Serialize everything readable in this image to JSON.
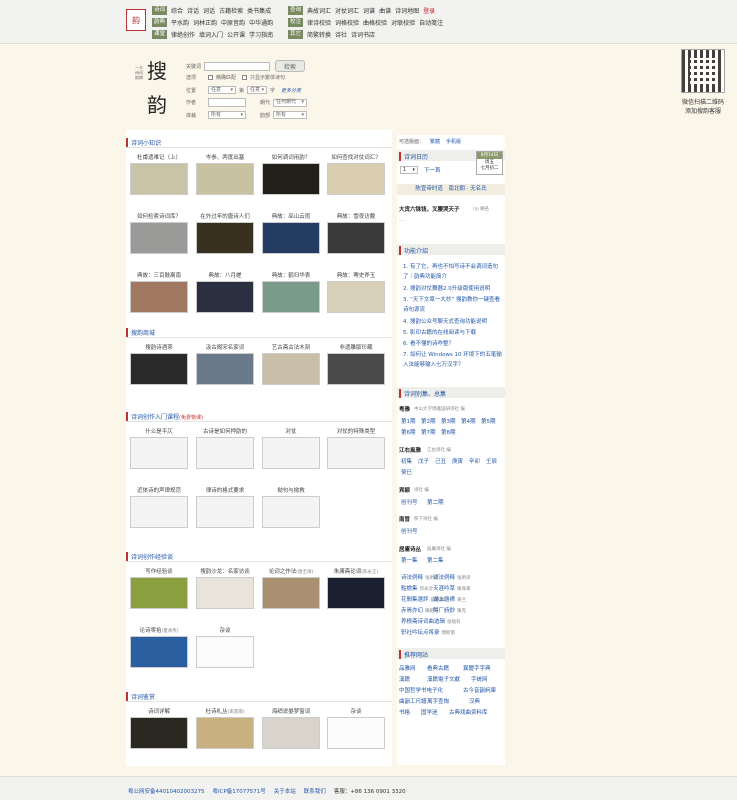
{
  "nav": {
    "logo_char": "韵",
    "row1_tag": "诗词",
    "row1": [
      "综合",
      "诗话",
      "词话",
      "古籍检索",
      "类书集成"
    ],
    "row2_tag": "韵典",
    "row2": [
      "平水韵",
      "词林正韵",
      "中原音韵",
      "中华通韵"
    ],
    "row3_tag": "课堂",
    "row3": [
      "律绝创作",
      "填词入门",
      "公开课",
      "学习指南"
    ],
    "row1b_tag": "查询",
    "row1b": [
      "典故词汇",
      "对仗词汇",
      "词谱",
      "曲谱",
      "诗词地图"
    ],
    "login": "登录",
    "row2b_tag": "校注",
    "row2b": [
      "律诗校验",
      "词格校验",
      "曲格校验",
      "对联校验",
      "自动笺注"
    ],
    "row3b_tag": "其它",
    "row3b": [
      "简繁转换",
      "诗社",
      "诗词书店"
    ]
  },
  "qr": {
    "line1": "微信扫描二维码",
    "line2": "添加搜韵客服"
  },
  "brand": {
    "char1": "搜",
    "char2": "韵",
    "side": "一卡诗词韵典"
  },
  "search": {
    "keyword_label": "关键词",
    "button": "检索",
    "option_label": "选项",
    "opt1": "精确匹配",
    "opt2": "只显示繁体诗句",
    "pos_label": "位置",
    "pos_value": "任意",
    "pos_mid": "第",
    "pos_value2": "任意",
    "pos_unit": "字",
    "more": "更多分类",
    "author_label": "作者",
    "dynasty_label": "朝代",
    "dynasty_value": "任何朝代",
    "genre_label": "体裁",
    "genre_value": "所有",
    "rhyme_label": "韵部",
    "rhyme_value": "所有"
  },
  "sections": {
    "knowledge": "诗词小知识",
    "shop": "搜韵商城",
    "course": "诗词创作入门课程",
    "course_note": "(免费物课)",
    "experience": "诗词创作经验谈",
    "appreciation": "诗词鉴赏"
  },
  "knowledge_items": [
    {
      "t": "杜甫遗难记（上）",
      "c": "#c9c3a8"
    },
    {
      "t": "岑参、两度出塞",
      "c": "#c8c2a0"
    },
    {
      "t": "如何调词用韵？",
      "c": "#222018"
    },
    {
      "t": "如何查找对仗词汇？",
      "c": "#d9cfb0"
    },
    {
      "t": "如何检索诗词库？",
      "c": "#9a9a98"
    },
    {
      "t": "在外过年的唐诗人们",
      "c": "#3a3020"
    },
    {
      "t": "典故：巫山云雨",
      "c": "#243c62"
    },
    {
      "t": "典故：雪夜访戴",
      "c": "#3a3a3a"
    },
    {
      "t": "典故：三百鼓离南",
      "c": "#a07860"
    },
    {
      "t": "典故：八月槎",
      "c": "#2a3040"
    },
    {
      "t": "典故：鹤归华表",
      "c": "#7a9a8a"
    },
    {
      "t": "典故：骞史斧玉",
      "c": "#d8cfb8"
    }
  ],
  "shop_items": [
    {
      "t": "搜韵诗酒茶",
      "c": "#2a2a2a"
    },
    {
      "t": "汲古阁宋名家词",
      "c": "#6a7a8a"
    },
    {
      "t": "艺古斋古法木刻",
      "c": "#c9bea8"
    },
    {
      "t": "非遗雕版珍藏",
      "c": "#4a4a4a"
    }
  ],
  "course_items": [
    {
      "t": "什么是平仄",
      "c": "#f4f4f4"
    },
    {
      "t": "古诗是如何押韵的",
      "c": "#f4f4f4"
    },
    {
      "t": "对仗",
      "c": "#f4f4f4"
    },
    {
      "t": "对仗的特殊类型",
      "c": "#f4f4f4"
    },
    {
      "t": "近体诗的声律规范",
      "c": "#f4f4f4"
    },
    {
      "t": "律诗的格式要求",
      "c": "#f4f4f4"
    },
    {
      "t": "拗句与拗救",
      "c": "#f4f4f4"
    }
  ],
  "exp_items": [
    {
      "t": "写作经验谈",
      "sub": "",
      "c": "#8aa040"
    },
    {
      "t": "搜韵沙龙：名家访谈",
      "sub": "",
      "c": "#e8e4dc"
    },
    {
      "t": "论词之作法",
      "sub": "(唐圭璋)",
      "c": "#a89070"
    },
    {
      "t": "朱庸斋论词",
      "sub": "(陈永正)",
      "c": "#1a2030"
    },
    {
      "t": "论诗零拾",
      "sub": "(夏承焘)",
      "c": "#2a60a0"
    },
    {
      "t": "杂谈",
      "sub": "",
      "c": "#fbfbfb"
    }
  ],
  "appr_items": [
    {
      "t": "诗词详解",
      "sub": "",
      "c": "#2a2820"
    },
    {
      "t": "杜诗札丛",
      "sub": "(束景南)",
      "c": "#c8b080"
    },
    {
      "t": "海绡说晏梦窗词",
      "sub": "",
      "c": "#d8d4cc"
    },
    {
      "t": "杂谈",
      "sub": "",
      "c": "#fbfbfb"
    }
  ],
  "right": {
    "version_label": "可选版面：",
    "v1": "繁體",
    "v2": "手机版",
    "calendar_title": "诗词日历",
    "cal_select": "1",
    "cal_next": "下一首",
    "date_box": [
      "8月14日",
      "周五",
      "七月初二"
    ],
    "poet_line": "陈宣帝时道　南北朝 · 无名氏",
    "verse": "大货六铢钱，叉腰哭天子",
    "verse_more": "(◎ 摘名",
    "verse_extra": "...",
    "features_title": "功能介绍",
    "features": [
      "有了它，再也不怕写诗不会调词造句了｜韵典功能简介",
      "搜韵对仗舞器2.0升级版使用说明",
      "“天下文章一大抄” 搜韵教你一键查看诗句源流",
      "搜韵公众号聊天式查询功能说明",
      "影印古籍的在线阅读与下载",
      "看不懂的诗咋整？",
      "如何让 Windows 10 环境下的五笔输入法能够输入七万汉字？"
    ],
    "journals_title": "诗词别集、总集",
    "j1_name": "粤雅",
    "j1_pub": "中山大学博雅国研诗社 编",
    "j1_issues": [
      "第1期",
      "第2期",
      "第3期",
      "第4期",
      "第5期",
      "第6期",
      "第7期",
      "第8期"
    ],
    "j2_name": "江右風雅",
    "j2_pub": "江右诗社 编",
    "j2_issues": [
      "初集",
      "戊子",
      "己丑",
      "庚寅",
      "辛卯",
      "壬辰",
      "癸巳"
    ],
    "j3_name": "宾颖",
    "j3_pub": "诗社 编",
    "j3_issues": [
      "创刊号",
      "第二期"
    ],
    "j4_name": "南冒",
    "j4_pub": "移下诗社 编",
    "j4_issues": [
      "创刊号"
    ],
    "j5_name": "居庸诗丛",
    "j5_pub": "居庸诗社 编",
    "j5_issues": [
      "第一集",
      "第二集"
    ],
    "misc": [
      [
        "诗法例释",
        "张舸译"
      ],
      [
        "词法例释",
        "张舸译"
      ],
      [
        "點擔集",
        "何永沂"
      ],
      [
        "天涯吟草",
        "陳偉東"
      ],
      [
        "花間集選評",
        "劉錦顯"
      ],
      [
        "湖上題襟",
        "黄兰"
      ],
      [
        "赤焉亦幻",
        "陳鉅平"
      ],
      [
        "酹厂詩鈔",
        "陳克"
      ],
      [
        "养根斋诗词曲选辑",
        "张福有"
      ],
      [
        "轵社吟坛点将录",
        "傅斯南"
      ]
    ],
    "links_title": "推荐网站",
    "links": [
      "品雅网",
      "看典古籍",
      "異體字字典",
      "漢籍",
      "漢籍電子文獻",
      "字统网",
      "中国哲学书电子化",
      "古今音韻詞庫",
      "曲韻工尺譜",
      "萬字查詢",
      "汉典",
      "书格",
      "国学迷",
      "古典戏曲资料库"
    ]
  },
  "footer": {
    "beian": "粤公网安备44010402003275",
    "icp": "粤ICP备17077571号",
    "about": "关于本站",
    "contact": "联系我们",
    "phone_label": "客服：",
    "phone": "+86 136 0901 3320"
  }
}
